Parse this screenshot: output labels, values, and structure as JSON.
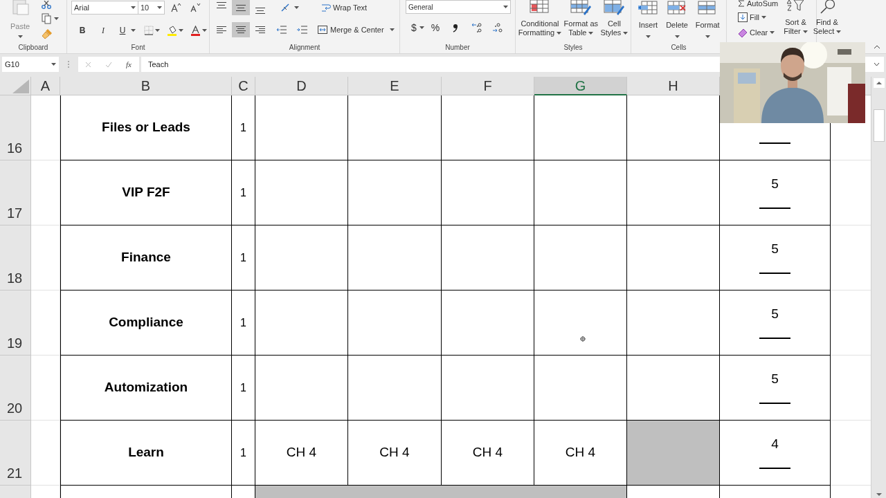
{
  "ribbon": {
    "clipboard": {
      "label": "Clipboard",
      "paste": "Paste"
    },
    "font": {
      "label": "Font",
      "font_name": "Arial",
      "font_size": "10",
      "bold": "B",
      "italic": "I",
      "underline": "U"
    },
    "alignment": {
      "label": "Alignment",
      "wrap_text": "Wrap Text",
      "merge_center": "Merge & Center",
      "vertical": [
        {
          "selected": false
        },
        {
          "selected": true
        },
        {
          "selected": false
        }
      ],
      "horizontal": [
        {
          "selected": false
        },
        {
          "selected": true
        },
        {
          "selected": false
        }
      ]
    },
    "number": {
      "label": "Number",
      "format": "General",
      "currency": "$",
      "percent": "%"
    },
    "styles": {
      "label": "Styles",
      "buttons": [
        {
          "lines": [
            "Conditional",
            "Formatting"
          ]
        },
        {
          "lines": [
            "Format as",
            "Table"
          ]
        },
        {
          "lines": [
            "Cell",
            "Styles"
          ]
        }
      ]
    },
    "cells": {
      "label": "Cells",
      "buttons": [
        "Insert",
        "Delete",
        "Format"
      ]
    },
    "editing": {
      "autosum": "AutoSum",
      "fill": "Fill",
      "clear": "Clear",
      "sort_filter": [
        "Sort &",
        "Filter"
      ],
      "find_select": [
        "Find &",
        "Select"
      ]
    }
  },
  "formula_bar": {
    "name_box": "G10",
    "fx": "fx",
    "formula": "Teach"
  },
  "columns": [
    {
      "letter": "A",
      "selected": false
    },
    {
      "letter": "B",
      "selected": false
    },
    {
      "letter": "C",
      "selected": false
    },
    {
      "letter": "D",
      "selected": false
    },
    {
      "letter": "E",
      "selected": false
    },
    {
      "letter": "F",
      "selected": false
    },
    {
      "letter": "G",
      "selected": true
    },
    {
      "letter": "H",
      "selected": false
    }
  ],
  "rows": [
    {
      "number": "16",
      "label": "Files or Leads",
      "count": "1",
      "cells": [
        {
          "shaded": false
        },
        {
          "shaded": false
        },
        {
          "shaded": false
        },
        {
          "shaded": false
        },
        {
          "shaded": false
        }
      ]
    },
    {
      "number": "17",
      "label": "VIP F2F",
      "count": "1",
      "score": "5",
      "cells": [
        {
          "shaded": false
        },
        {
          "shaded": false
        },
        {
          "shaded": false
        },
        {
          "shaded": false
        },
        {
          "shaded": false
        }
      ]
    },
    {
      "number": "18",
      "label": "Finance",
      "count": "1",
      "score": "5",
      "cells": [
        {
          "shaded": false
        },
        {
          "shaded": false
        },
        {
          "shaded": false
        },
        {
          "shaded": false
        },
        {
          "shaded": false
        }
      ]
    },
    {
      "number": "19",
      "label": "Compliance",
      "count": "1",
      "score": "5",
      "cells": [
        {
          "shaded": false
        },
        {
          "shaded": false
        },
        {
          "shaded": false
        },
        {
          "shaded": false
        },
        {
          "shaded": false
        }
      ]
    },
    {
      "number": "20",
      "label": "Automization",
      "count": "1",
      "score": "5",
      "cells": [
        {
          "shaded": false
        },
        {
          "shaded": false
        },
        {
          "shaded": false
        },
        {
          "shaded": false
        },
        {
          "shaded": false
        }
      ]
    },
    {
      "number": "21",
      "label": "Learn",
      "count": "1",
      "score": "4",
      "cells": [
        {
          "text": "CH 4",
          "shaded": false
        },
        {
          "text": "CH 4",
          "shaded": false
        },
        {
          "text": "CH 4",
          "shaded": false
        },
        {
          "text": "CH 4",
          "shaded": false
        },
        {
          "shaded": true
        }
      ]
    },
    {
      "cells": [
        {
          "shaded": true
        },
        {
          "shaded": true
        },
        {
          "shaded": true
        },
        {
          "shaded": true
        },
        {
          "shaded": false
        }
      ]
    }
  ]
}
